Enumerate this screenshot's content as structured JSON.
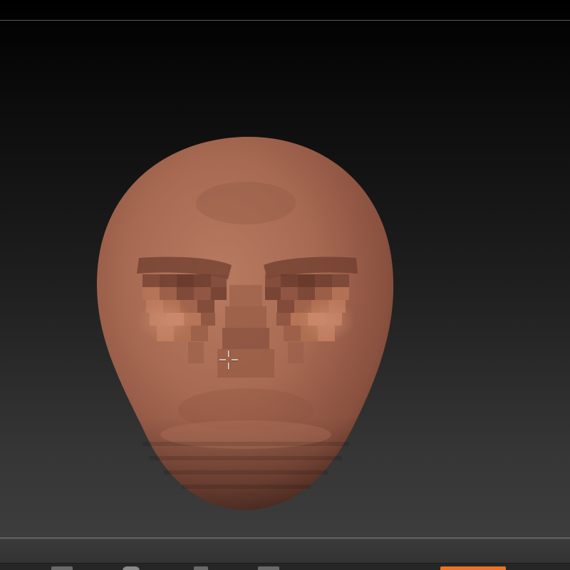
{
  "viewport": {
    "model": "head-sculpt",
    "skin_color": "#a86a52",
    "background_top": "#000000",
    "background_bottom": "#3d3d3d"
  },
  "bottom_shelf": {
    "buttons": [
      {
        "icon": "tool-icon"
      },
      {
        "icon": "sphere-icon"
      },
      {
        "icon": "brush-icon"
      },
      {
        "icon": "stroke-icon"
      },
      {
        "icon": "edit-icon",
        "active": true
      }
    ],
    "accent_color": "#e8742a"
  }
}
